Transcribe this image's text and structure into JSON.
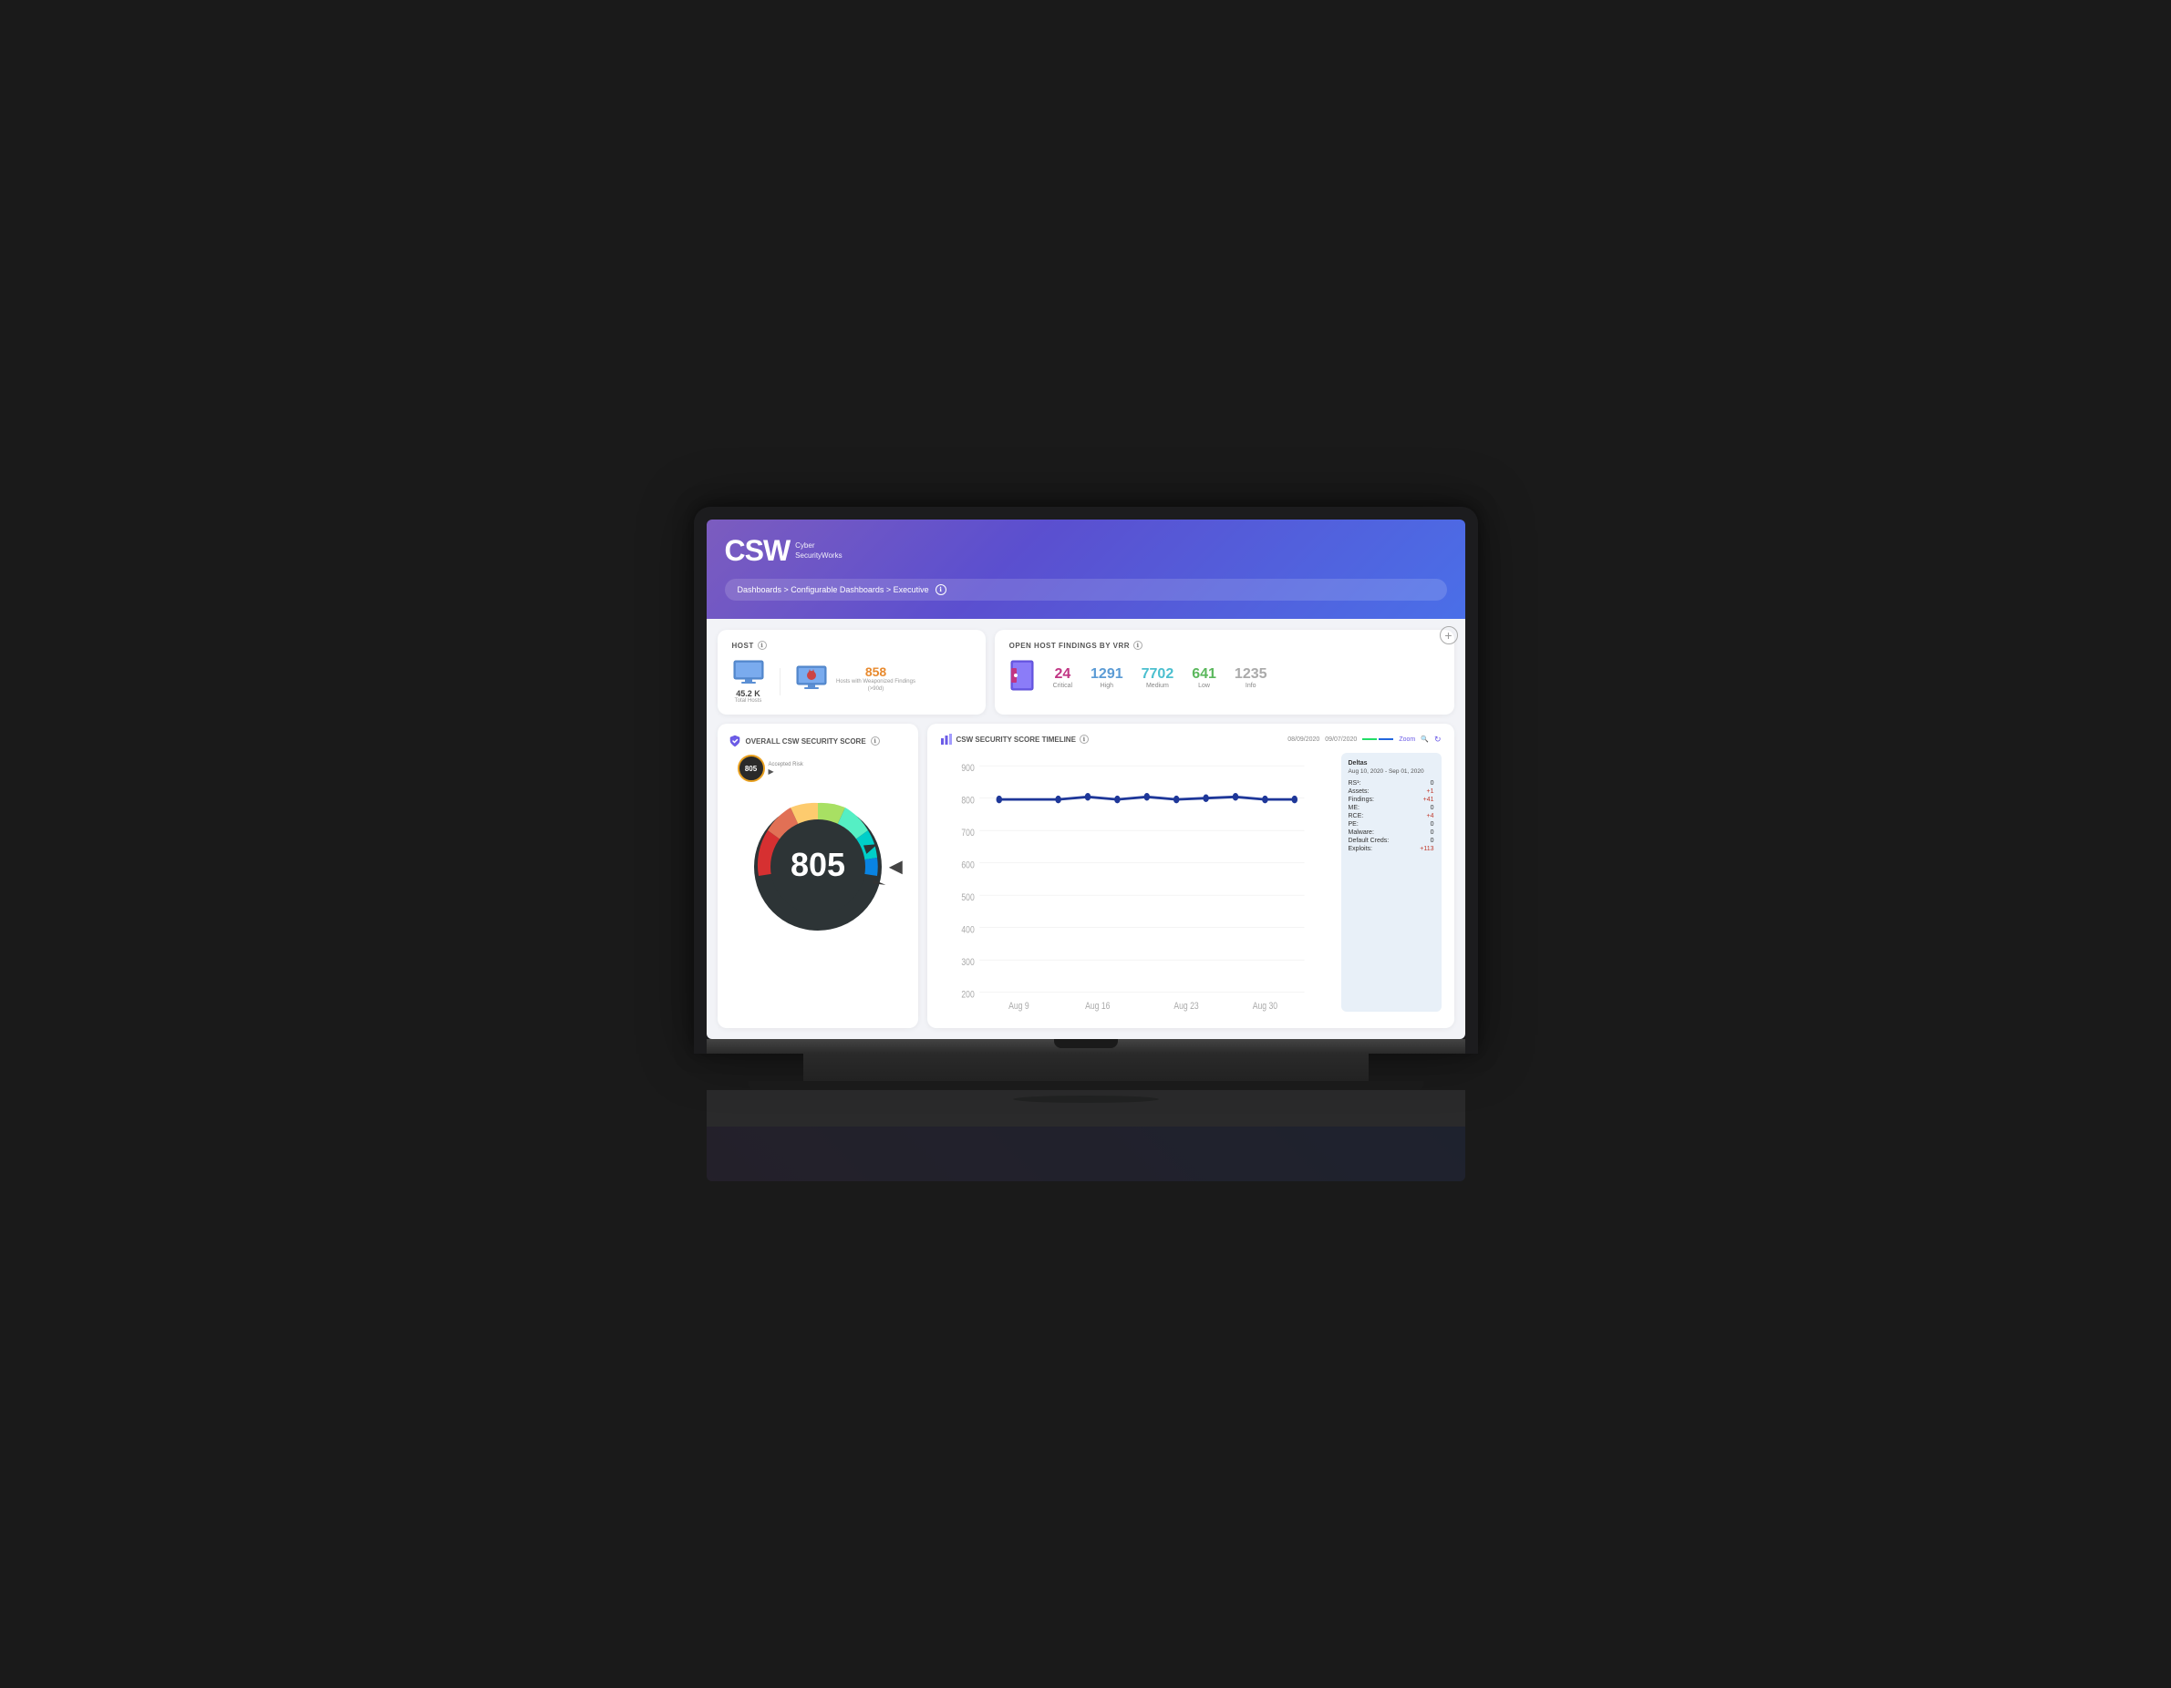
{
  "laptop": {
    "screen": {
      "header": {
        "logo": "CSW",
        "logo_sub1": "Cyber",
        "logo_sub2": "SecurityWorks",
        "breadcrumb": "Dashboards > Configurable Dashboards > Executive",
        "info_icon": "ℹ"
      },
      "add_button": "+",
      "host_card": {
        "title": "HOST",
        "total_hosts_value": "45.2 K",
        "total_hosts_label": "Total Hosts",
        "weaponized_value": "858",
        "weaponized_label": "Hosts with Weaponized Findings (>90d)"
      },
      "findings_card": {
        "title": "OPEN HOST FINDINGS BY VRR",
        "critical_value": "24",
        "critical_label": "Critical",
        "high_value": "1291",
        "high_label": "High",
        "medium_value": "7702",
        "medium_label": "Medium",
        "low_value": "641",
        "low_label": "Low",
        "info_value": "1235",
        "info_label": "Info"
      },
      "score_card": {
        "title": "OVERALL CSW SECURITY SCORE",
        "small_score": "805",
        "small_label": "Accepted Risk",
        "big_score": "805",
        "arrow": "▶"
      },
      "timeline_card": {
        "title": "CSW SECURITY SCORE TIMELINE",
        "date1": "08/09/2020",
        "date2": "09/07/2020",
        "zoom_label": "Zoom",
        "chart_labels": [
          "Aug 9",
          "Aug 16",
          "Aug 23",
          "Aug 30"
        ],
        "chart_y_labels": [
          "900",
          "800",
          "700",
          "600",
          "500",
          "400",
          "300",
          "200"
        ],
        "deltas_title": "Deltas",
        "deltas_date": "Aug 10, 2020 - Sep 01, 2020",
        "deltas": [
          {
            "label": "RS¹:",
            "value": "0",
            "type": "zero"
          },
          {
            "label": "Assets:",
            "value": "+1",
            "type": "pos"
          },
          {
            "label": "Findings:",
            "value": "+41",
            "type": "pos"
          },
          {
            "label": "ME:",
            "value": "0",
            "type": "zero"
          },
          {
            "label": "RCE:",
            "value": "+4",
            "type": "pos"
          },
          {
            "label": "PE:",
            "value": "0",
            "type": "zero"
          },
          {
            "label": "Malware:",
            "value": "0",
            "type": "zero"
          },
          {
            "label": "Default Creds:",
            "value": "0",
            "type": "zero"
          },
          {
            "label": "Exploits:",
            "value": "+113",
            "type": "pos"
          }
        ]
      }
    }
  },
  "colors": {
    "header_gradient_start": "#7c5cbf",
    "header_gradient_end": "#4a6fe8",
    "critical": "#c13584",
    "high": "#5b9bd5",
    "medium": "#4bbfcf",
    "low": "#5bb85d",
    "info": "#aaaaaa",
    "gauge_red": "#d63031",
    "gauge_orange": "#e17055",
    "gauge_yellow": "#fdcb6e",
    "gauge_green": "#55efc4",
    "gauge_teal": "#00cec9",
    "gauge_blue": "#0984e3",
    "gauge_dark_bg": "#2d3436",
    "deltas_panel_bg": "#e8f0f8",
    "accent_purple": "#6c5ce7"
  }
}
